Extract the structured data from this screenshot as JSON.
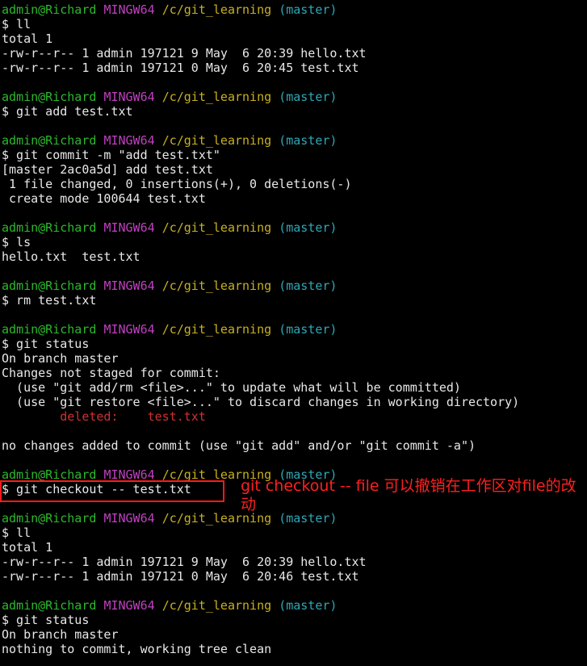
{
  "prompt": {
    "user": "admin@Richard",
    "shell": "MINGW64",
    "path": "/c/git_learning",
    "branch": "(master)"
  },
  "session": [
    {
      "cmd": "$ ll",
      "output": [
        "total 1",
        "-rw-r--r-- 1 admin 197121 9 May  6 20:39 hello.txt",
        "-rw-r--r-- 1 admin 197121 0 May  6 20:45 test.txt"
      ]
    },
    {
      "cmd": "$ git add test.txt",
      "output": []
    },
    {
      "cmd": "$ git commit -m \"add test.txt\"",
      "output": [
        "[master 2ac0a5d] add test.txt",
        " 1 file changed, 0 insertions(+), 0 deletions(-)",
        " create mode 100644 test.txt"
      ]
    },
    {
      "cmd": "$ ls",
      "output": [
        "hello.txt  test.txt"
      ]
    },
    {
      "cmd": "$ rm test.txt",
      "output": []
    },
    {
      "cmd": "$ git status",
      "output_before": [
        "On branch master",
        "Changes not staged for commit:",
        "  (use \"git add/rm <file>...\" to update what will be committed)",
        "  (use \"git restore <file>...\" to discard changes in working directory)"
      ],
      "deleted_label": "        deleted:    test.txt",
      "output_after": [
        "",
        "no changes added to commit (use \"git add\" and/or \"git commit -a\")"
      ]
    },
    {
      "cmd": "$ git checkout -- test.txt",
      "output": []
    },
    {
      "cmd": "$ ll",
      "output": [
        "total 1",
        "-rw-r--r-- 1 admin 197121 9 May  6 20:39 hello.txt",
        "-rw-r--r-- 1 admin 197121 0 May  6 20:46 test.txt"
      ]
    },
    {
      "cmd": "$ git status",
      "output": [
        "On branch master",
        "nothing to commit, working tree clean"
      ]
    }
  ],
  "annotation": {
    "text": "git checkout -- file 可以撤销在工作区对file的改动"
  },
  "colors": {
    "background": "#000000",
    "text": "#e8e8e8",
    "user": "#2cb82c",
    "shell": "#c040c0",
    "path": "#c8b020",
    "branch": "#2ea8b8",
    "deleted": "#d03030",
    "annotation": "#ff2020"
  }
}
